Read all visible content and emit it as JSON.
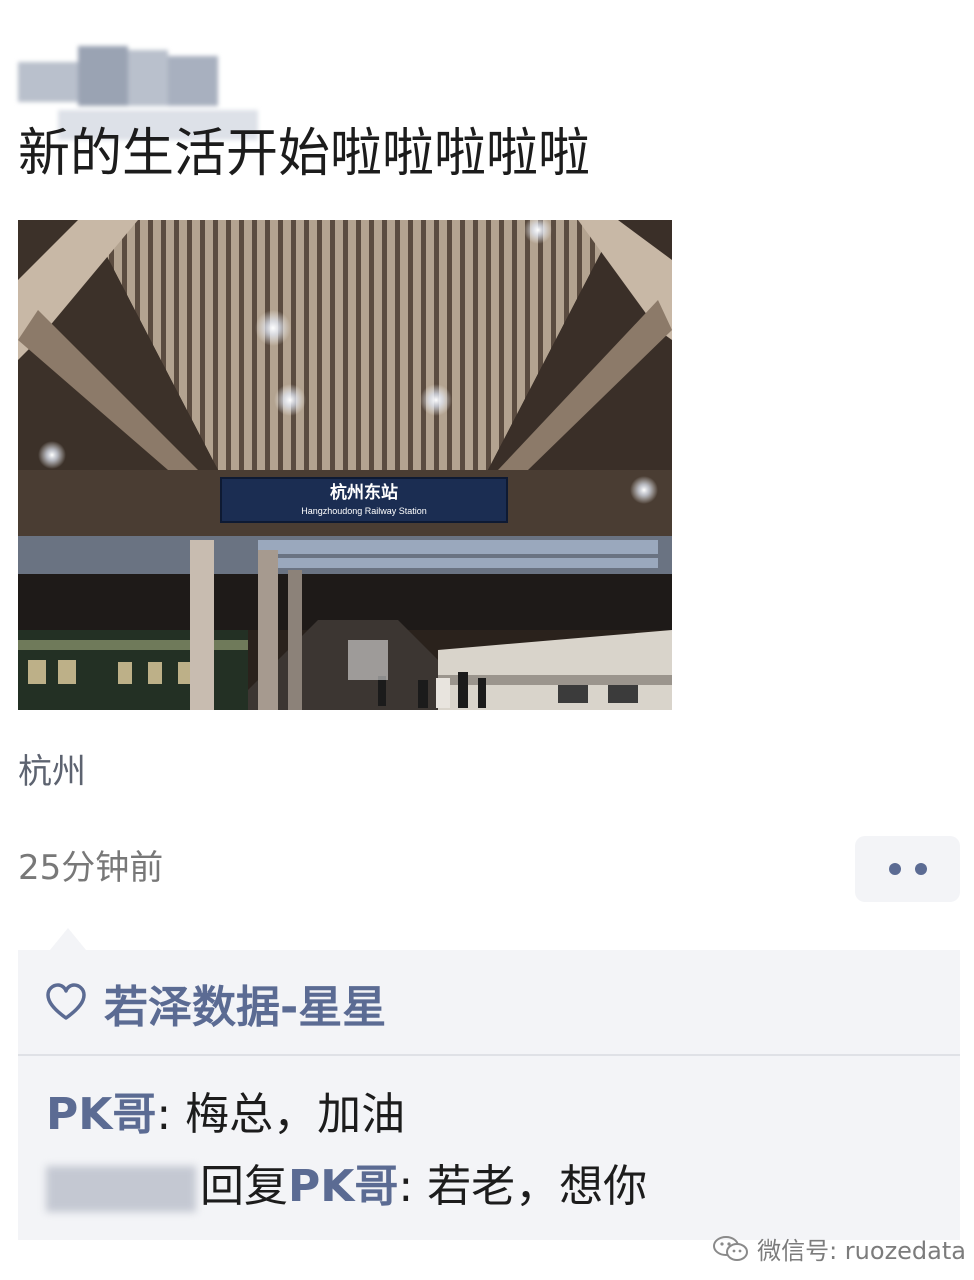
{
  "post": {
    "text": "新的生活开始啦啦啦啦啦",
    "location": "杭州",
    "time": "25分钟前"
  },
  "photo": {
    "sign_cn": "杭州东站",
    "sign_en": "Hangzhoudong Railway Station"
  },
  "likes": {
    "icon": "heart-icon",
    "names": "若泽数据-星星"
  },
  "comments": [
    {
      "user": "PK哥",
      "sep": ": ",
      "text": "梅总，加油"
    },
    {
      "reply_word": "回复",
      "reply_to": "PK哥",
      "sep": ": ",
      "text": "若老，想你"
    }
  ],
  "more_button": {
    "icon": "more-dots-icon"
  },
  "watermark": {
    "text": "微信号: ruozedata",
    "icon": "wechat-icon"
  },
  "colors": {
    "link": "#5b6b93",
    "panel": "#f3f4f7",
    "text": "#1c1c1c",
    "muted": "#787878"
  }
}
